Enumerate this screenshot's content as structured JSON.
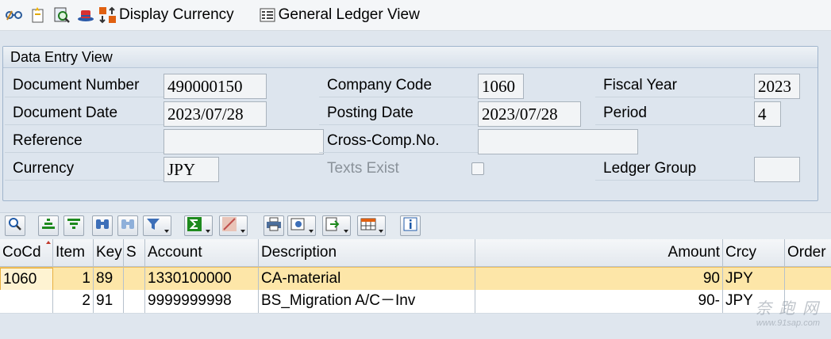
{
  "toolbar": {
    "display_currency_label": "Display Currency",
    "general_ledger_label": "General Ledger View"
  },
  "panel": {
    "title": "Data Entry View",
    "document_number_label": "Document Number",
    "document_number_value": "490000150",
    "company_code_label": "Company Code",
    "company_code_value": "1060",
    "fiscal_year_label": "Fiscal Year",
    "fiscal_year_value": "2023",
    "document_date_label": "Document Date",
    "document_date_value": "2023/07/28",
    "posting_date_label": "Posting Date",
    "posting_date_value": "2023/07/28",
    "period_label": "Period",
    "period_value": "4",
    "reference_label": "Reference",
    "reference_value": "",
    "cross_comp_label": "Cross-Comp.No.",
    "cross_comp_value": "",
    "currency_label": "Currency",
    "currency_value": "JPY",
    "texts_exist_label": "Texts Exist",
    "ledger_group_label": "Ledger Group",
    "ledger_group_value": ""
  },
  "grid": {
    "headers": {
      "cocd": "CoCd",
      "item": "Item",
      "key": "Key",
      "s": "S",
      "account": "Account",
      "description": "Description",
      "amount": "Amount",
      "crcy": "Crcy",
      "order": "Order"
    },
    "rows": [
      {
        "cocd": "1060",
        "item": "1",
        "key": "89",
        "s": "",
        "account": "1330100000",
        "description": "CA-material",
        "amount": "90",
        "crcy": "JPY",
        "order": ""
      },
      {
        "cocd": "",
        "item": "2",
        "key": "91",
        "s": "",
        "account": "9999999998",
        "description": "BS_Migration A/C－Inv",
        "amount": "90-",
        "crcy": "JPY",
        "order": ""
      }
    ]
  },
  "watermark": {
    "brand": "奈 跑 网",
    "url": "www.91sap.com"
  },
  "colors": {
    "selected_row": "#fde6a8",
    "panel_border": "#9fb4cc",
    "background": "#dfe6ee"
  }
}
